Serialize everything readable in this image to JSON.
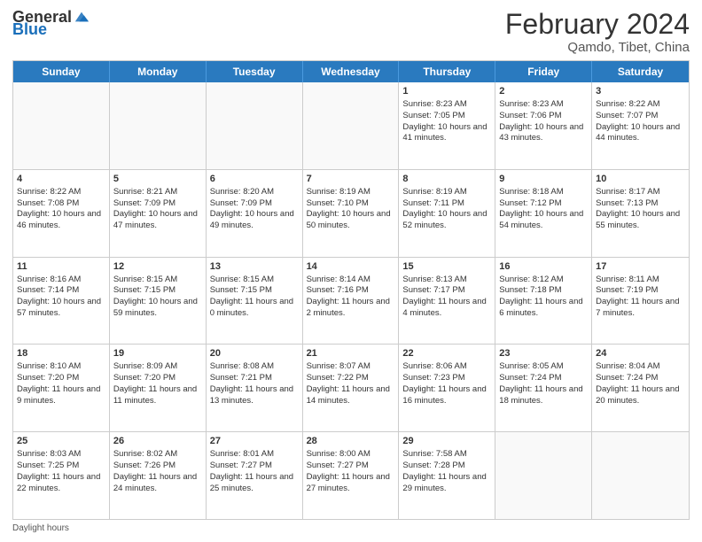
{
  "logo": {
    "general": "General",
    "blue": "Blue"
  },
  "title": "February 2024",
  "location": "Qamdo, Tibet, China",
  "days_of_week": [
    "Sunday",
    "Monday",
    "Tuesday",
    "Wednesday",
    "Thursday",
    "Friday",
    "Saturday"
  ],
  "footer": "Daylight hours",
  "weeks": [
    [
      {
        "day": "",
        "sunrise": "",
        "sunset": "",
        "daylight": "",
        "empty": true
      },
      {
        "day": "",
        "sunrise": "",
        "sunset": "",
        "daylight": "",
        "empty": true
      },
      {
        "day": "",
        "sunrise": "",
        "sunset": "",
        "daylight": "",
        "empty": true
      },
      {
        "day": "",
        "sunrise": "",
        "sunset": "",
        "daylight": "",
        "empty": true
      },
      {
        "day": "1",
        "sunrise": "Sunrise: 8:23 AM",
        "sunset": "Sunset: 7:05 PM",
        "daylight": "Daylight: 10 hours and 41 minutes."
      },
      {
        "day": "2",
        "sunrise": "Sunrise: 8:23 AM",
        "sunset": "Sunset: 7:06 PM",
        "daylight": "Daylight: 10 hours and 43 minutes."
      },
      {
        "day": "3",
        "sunrise": "Sunrise: 8:22 AM",
        "sunset": "Sunset: 7:07 PM",
        "daylight": "Daylight: 10 hours and 44 minutes."
      }
    ],
    [
      {
        "day": "4",
        "sunrise": "Sunrise: 8:22 AM",
        "sunset": "Sunset: 7:08 PM",
        "daylight": "Daylight: 10 hours and 46 minutes."
      },
      {
        "day": "5",
        "sunrise": "Sunrise: 8:21 AM",
        "sunset": "Sunset: 7:09 PM",
        "daylight": "Daylight: 10 hours and 47 minutes."
      },
      {
        "day": "6",
        "sunrise": "Sunrise: 8:20 AM",
        "sunset": "Sunset: 7:09 PM",
        "daylight": "Daylight: 10 hours and 49 minutes."
      },
      {
        "day": "7",
        "sunrise": "Sunrise: 8:19 AM",
        "sunset": "Sunset: 7:10 PM",
        "daylight": "Daylight: 10 hours and 50 minutes."
      },
      {
        "day": "8",
        "sunrise": "Sunrise: 8:19 AM",
        "sunset": "Sunset: 7:11 PM",
        "daylight": "Daylight: 10 hours and 52 minutes."
      },
      {
        "day": "9",
        "sunrise": "Sunrise: 8:18 AM",
        "sunset": "Sunset: 7:12 PM",
        "daylight": "Daylight: 10 hours and 54 minutes."
      },
      {
        "day": "10",
        "sunrise": "Sunrise: 8:17 AM",
        "sunset": "Sunset: 7:13 PM",
        "daylight": "Daylight: 10 hours and 55 minutes."
      }
    ],
    [
      {
        "day": "11",
        "sunrise": "Sunrise: 8:16 AM",
        "sunset": "Sunset: 7:14 PM",
        "daylight": "Daylight: 10 hours and 57 minutes."
      },
      {
        "day": "12",
        "sunrise": "Sunrise: 8:15 AM",
        "sunset": "Sunset: 7:15 PM",
        "daylight": "Daylight: 10 hours and 59 minutes."
      },
      {
        "day": "13",
        "sunrise": "Sunrise: 8:15 AM",
        "sunset": "Sunset: 7:15 PM",
        "daylight": "Daylight: 11 hours and 0 minutes."
      },
      {
        "day": "14",
        "sunrise": "Sunrise: 8:14 AM",
        "sunset": "Sunset: 7:16 PM",
        "daylight": "Daylight: 11 hours and 2 minutes."
      },
      {
        "day": "15",
        "sunrise": "Sunrise: 8:13 AM",
        "sunset": "Sunset: 7:17 PM",
        "daylight": "Daylight: 11 hours and 4 minutes."
      },
      {
        "day": "16",
        "sunrise": "Sunrise: 8:12 AM",
        "sunset": "Sunset: 7:18 PM",
        "daylight": "Daylight: 11 hours and 6 minutes."
      },
      {
        "day": "17",
        "sunrise": "Sunrise: 8:11 AM",
        "sunset": "Sunset: 7:19 PM",
        "daylight": "Daylight: 11 hours and 7 minutes."
      }
    ],
    [
      {
        "day": "18",
        "sunrise": "Sunrise: 8:10 AM",
        "sunset": "Sunset: 7:20 PM",
        "daylight": "Daylight: 11 hours and 9 minutes."
      },
      {
        "day": "19",
        "sunrise": "Sunrise: 8:09 AM",
        "sunset": "Sunset: 7:20 PM",
        "daylight": "Daylight: 11 hours and 11 minutes."
      },
      {
        "day": "20",
        "sunrise": "Sunrise: 8:08 AM",
        "sunset": "Sunset: 7:21 PM",
        "daylight": "Daylight: 11 hours and 13 minutes."
      },
      {
        "day": "21",
        "sunrise": "Sunrise: 8:07 AM",
        "sunset": "Sunset: 7:22 PM",
        "daylight": "Daylight: 11 hours and 14 minutes."
      },
      {
        "day": "22",
        "sunrise": "Sunrise: 8:06 AM",
        "sunset": "Sunset: 7:23 PM",
        "daylight": "Daylight: 11 hours and 16 minutes."
      },
      {
        "day": "23",
        "sunrise": "Sunrise: 8:05 AM",
        "sunset": "Sunset: 7:24 PM",
        "daylight": "Daylight: 11 hours and 18 minutes."
      },
      {
        "day": "24",
        "sunrise": "Sunrise: 8:04 AM",
        "sunset": "Sunset: 7:24 PM",
        "daylight": "Daylight: 11 hours and 20 minutes."
      }
    ],
    [
      {
        "day": "25",
        "sunrise": "Sunrise: 8:03 AM",
        "sunset": "Sunset: 7:25 PM",
        "daylight": "Daylight: 11 hours and 22 minutes."
      },
      {
        "day": "26",
        "sunrise": "Sunrise: 8:02 AM",
        "sunset": "Sunset: 7:26 PM",
        "daylight": "Daylight: 11 hours and 24 minutes."
      },
      {
        "day": "27",
        "sunrise": "Sunrise: 8:01 AM",
        "sunset": "Sunset: 7:27 PM",
        "daylight": "Daylight: 11 hours and 25 minutes."
      },
      {
        "day": "28",
        "sunrise": "Sunrise: 8:00 AM",
        "sunset": "Sunset: 7:27 PM",
        "daylight": "Daylight: 11 hours and 27 minutes."
      },
      {
        "day": "29",
        "sunrise": "Sunrise: 7:58 AM",
        "sunset": "Sunset: 7:28 PM",
        "daylight": "Daylight: 11 hours and 29 minutes."
      },
      {
        "day": "",
        "sunrise": "",
        "sunset": "",
        "daylight": "",
        "empty": true
      },
      {
        "day": "",
        "sunrise": "",
        "sunset": "",
        "daylight": "",
        "empty": true
      }
    ]
  ]
}
